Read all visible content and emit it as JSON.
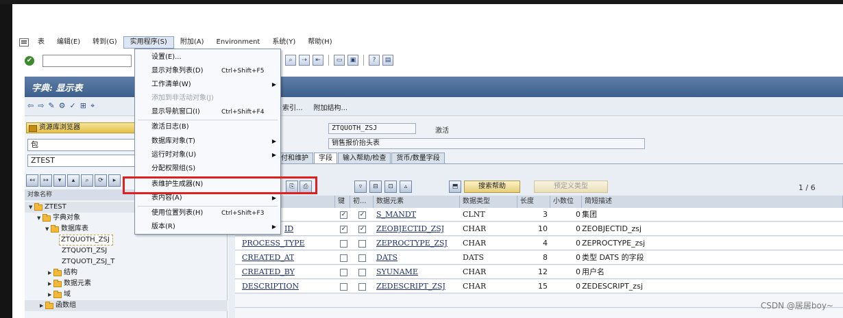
{
  "menubar": {
    "items": [
      "表",
      "编辑(E)",
      "转到(G)",
      "实用程序(S)",
      "附加(A)",
      "Environment",
      "系统(Y)",
      "帮助(H)"
    ]
  },
  "title": "字典: 显示表",
  "app_toolbar": {
    "buttons": [
      "索引...",
      "附加结构..."
    ]
  },
  "left_panel": {
    "header": "资源库浏览器",
    "field1": "包",
    "field2": "ZTEST",
    "tree_header": "对象名称",
    "tree": [
      {
        "label": "ZTEST",
        "type": "folder",
        "expanded": true
      },
      {
        "label": "字典对象",
        "type": "folder",
        "expanded": true
      },
      {
        "label": "数据库表",
        "type": "folder",
        "expanded": true
      },
      {
        "label": "ZTQUOTH_ZSJ",
        "type": "item",
        "selected": true
      },
      {
        "label": "ZTQUOTI_ZSJ",
        "type": "item"
      },
      {
        "label": "ZTQUOTI_ZSJ_T",
        "type": "item"
      },
      {
        "label": "结构",
        "type": "folder"
      },
      {
        "label": "数据元素",
        "type": "folder"
      },
      {
        "label": "域",
        "type": "folder"
      },
      {
        "label": "函数组",
        "type": "folder"
      }
    ]
  },
  "main": {
    "table_name": "ZTQUOTH_ZSJ",
    "status": "激活",
    "description": "销售报价抬头表",
    "tabs": [
      "交付和维护",
      "字段",
      "输入帮助/检查",
      "货币/数量字段"
    ],
    "active_tab": "字段",
    "search_help_btn": "搜索帮助",
    "predefined_type_btn": "预定义类型",
    "pager": "1 / 6",
    "columns": [
      "",
      "键",
      "初...",
      "数据元素",
      "数据类型",
      "长度",
      "小数位",
      "简短描述"
    ],
    "rows": [
      {
        "field": "",
        "key": true,
        "init": true,
        "element": "S_MANDT",
        "type": "CLNT",
        "len": "3",
        "dec": "0",
        "desc": "集团"
      },
      {
        "field": "ID",
        "key": true,
        "init": true,
        "element": "ZEOBJECTID_ZSJ",
        "type": "CHAR",
        "len": "10",
        "dec": "0",
        "desc": "ZEOBJECTID_zsj"
      },
      {
        "field": "PROCESS_TYPE",
        "key": false,
        "init": false,
        "element": "ZEPROCTYPE_ZSJ",
        "type": "CHAR",
        "len": "4",
        "dec": "0",
        "desc": "ZEPROCTYPE_zsj"
      },
      {
        "field": "CREATED_AT",
        "key": false,
        "init": false,
        "element": "DATS",
        "type": "DATS",
        "len": "8",
        "dec": "0",
        "desc": "类型 DATS 的字段"
      },
      {
        "field": "CREATED_BY",
        "key": false,
        "init": false,
        "element": "SYUNAME",
        "type": "CHAR",
        "len": "12",
        "dec": "0",
        "desc": "用户名"
      },
      {
        "field": "DESCRIPTION",
        "key": false,
        "init": false,
        "element": "ZEDESCRIPT_ZSJ",
        "type": "CHAR",
        "len": "15",
        "dec": "0",
        "desc": "ZEDESCRIPT_zsj"
      }
    ]
  },
  "dropdown": {
    "items": [
      {
        "label": "设置(E)...",
        "shortcut": "",
        "arrow": false,
        "disabled": false
      },
      {
        "label": "显示对象列表(D)",
        "shortcut": "Ctrl+Shift+F5",
        "arrow": false,
        "disabled": false
      },
      {
        "label": "工作清单(W)",
        "shortcut": "",
        "arrow": true,
        "disabled": false
      },
      {
        "label": "添加到非活动对象(J)",
        "shortcut": "",
        "arrow": false,
        "disabled": true
      },
      {
        "label": "显示导航窗口(I)",
        "shortcut": "Ctrl+Shift+F4",
        "arrow": false,
        "disabled": false
      },
      {
        "label": "激活日志(B)",
        "shortcut": "",
        "arrow": false,
        "disabled": false
      },
      {
        "label": "数据库对象(T)",
        "shortcut": "",
        "arrow": true,
        "disabled": false
      },
      {
        "label": "运行时对象(U)",
        "shortcut": "",
        "arrow": true,
        "disabled": false
      },
      {
        "label": "分配权限组(S)",
        "shortcut": "",
        "arrow": false,
        "disabled": false
      },
      {
        "label": "表维护生成器(N)",
        "shortcut": "",
        "arrow": false,
        "disabled": false
      },
      {
        "label": "表内容(A)",
        "shortcut": "",
        "arrow": true,
        "disabled": false
      },
      {
        "label": "使用位置列表(H)",
        "shortcut": "Ctrl+Shift+F3",
        "arrow": false,
        "disabled": false
      },
      {
        "label": "版本(R)",
        "shortcut": "",
        "arrow": true,
        "disabled": false
      }
    ]
  },
  "watermark": "CSDN @居居boy~",
  "colors": {
    "highlight": "#e21d1d",
    "title_bar": "#4a6b96"
  }
}
